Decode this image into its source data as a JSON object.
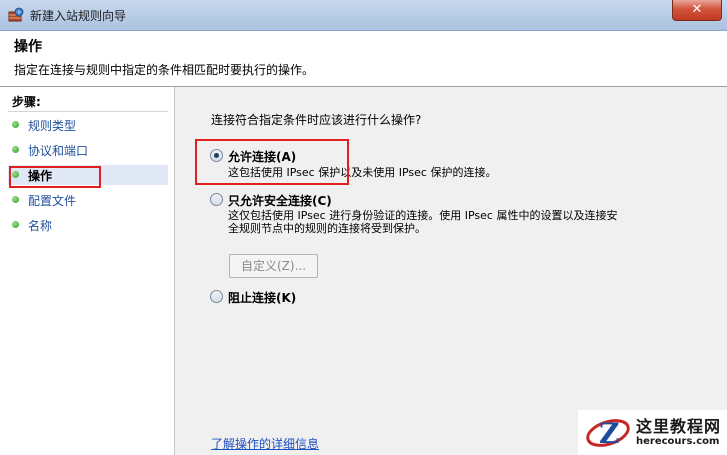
{
  "window": {
    "title": "新建入站规则向导",
    "close_glyph": "✕"
  },
  "header": {
    "title": "操作",
    "description": "指定在连接与规则中指定的条件相匹配时要执行的操作。"
  },
  "sidebar": {
    "steps_label": "步骤:",
    "items": [
      {
        "label": "规则类型",
        "current": false
      },
      {
        "label": "协议和端口",
        "current": false
      },
      {
        "label": "操作",
        "current": true
      },
      {
        "label": "配置文件",
        "current": false
      },
      {
        "label": "名称",
        "current": false
      }
    ]
  },
  "main": {
    "question": "连接符合指定条件时应该进行什么操作?",
    "options": [
      {
        "label": "允许连接(A)",
        "checked": true,
        "desc": "这包括使用 IPsec 保护以及未使用 IPsec 保护的连接。"
      },
      {
        "label": "只允许安全连接(C)",
        "checked": false,
        "desc_line1": "这仅包括使用 IPsec 进行身份验证的连接。使用 IPsec 属性中的设置以及连接安",
        "desc_line2": "全规则节点中的规则的连接将受到保护。"
      },
      {
        "label": "阻止连接(K)",
        "checked": false
      }
    ],
    "custom_button": "自定义(Z)...",
    "learn_more_link": "了解操作的详细信息"
  },
  "watermark": {
    "site_name": "这里教程网",
    "site_url": "herecours.com"
  },
  "colors": {
    "highlight_box": "#e02020",
    "link": "#1f4fbf",
    "step_dot": "#2f9b25"
  }
}
